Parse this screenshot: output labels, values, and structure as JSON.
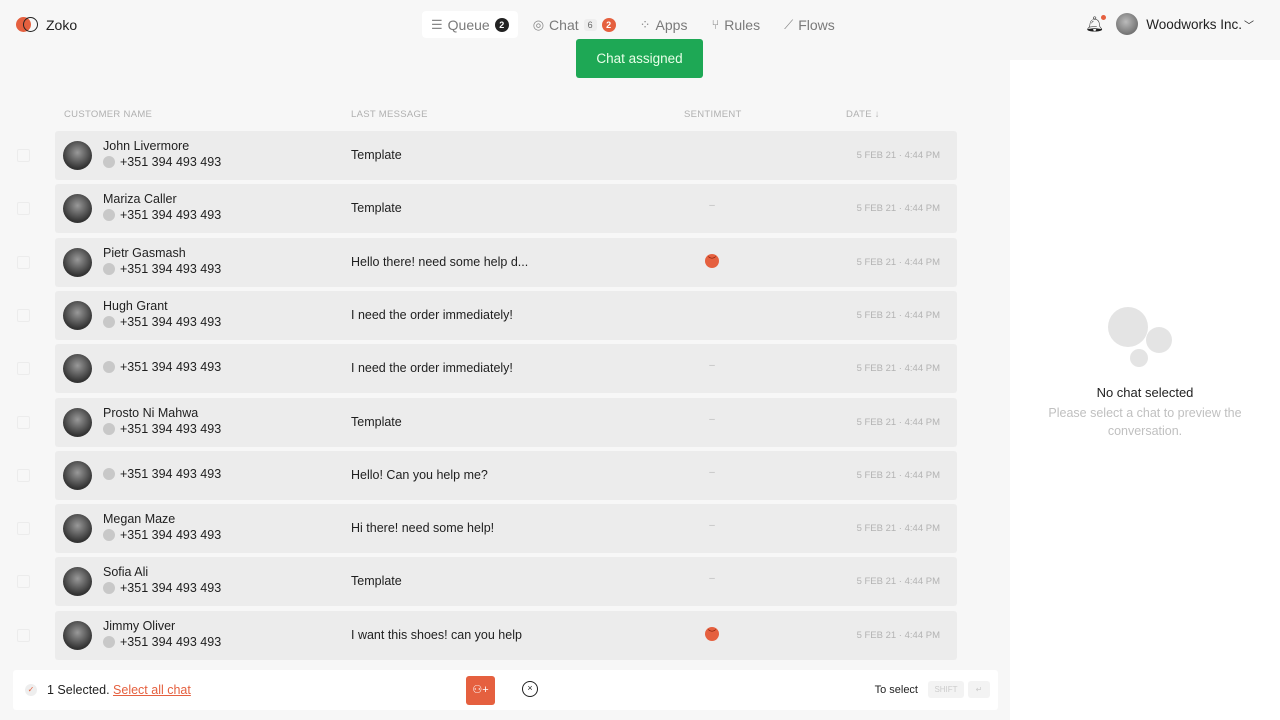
{
  "app": {
    "name": "Zoko",
    "logo_colors": [
      "#e5603f",
      "#222222"
    ]
  },
  "nav": [
    {
      "label": "Queue",
      "icon": "queue-icon",
      "badge": "2",
      "active": true
    },
    {
      "label": "Chat",
      "icon": "chat-icon",
      "count": "6",
      "badge": "2"
    },
    {
      "label": "Apps",
      "icon": "apps-icon"
    },
    {
      "label": "Rules",
      "icon": "rules-icon"
    },
    {
      "label": "Flows",
      "icon": "flows-icon"
    }
  ],
  "toast": {
    "text": "Chat assigned",
    "color": "#1ea855"
  },
  "account": {
    "name": "Woodworks Inc.",
    "notification_dot": true
  },
  "table": {
    "headers": {
      "name": "CUSTOMER NAME",
      "message": "LAST MESSAGE",
      "sentiment": "SENTIMENT",
      "date": "DATE ↓"
    },
    "rows": [
      {
        "name": "John Livermore",
        "phone": "+351 394 493 493",
        "message": "Template",
        "sentiment": "",
        "date": "5 FEB 21 · 4:44 PM"
      },
      {
        "name": "Mariza Caller",
        "phone": "+351 394 493 493",
        "message": "Template",
        "sentiment": "–",
        "date": "5 FEB 21 · 4:44 PM"
      },
      {
        "name": "Pietr Gasmash",
        "phone": "+351 394 493 493",
        "message": "Hello there! need some help d...",
        "sentiment": "angry",
        "date": "5 FEB 21 · 4:44 PM"
      },
      {
        "name": "Hugh Grant",
        "phone": "+351 394 493 493",
        "message": "I need the order immediately!",
        "sentiment": "",
        "date": "5 FEB 21 · 4:44 PM"
      },
      {
        "name": "",
        "phone": "+351 394 493 493",
        "message": "I need the order immediately!",
        "sentiment": "–",
        "date": "5 FEB 21 · 4:44 PM"
      },
      {
        "name": "Prosto Ni Mahwa",
        "phone": "+351 394 493 493",
        "message": "Template",
        "sentiment": "–",
        "date": "5 FEB 21 · 4:44 PM"
      },
      {
        "name": "",
        "phone": "+351 394 493 493",
        "message": "Hello! Can you help me?",
        "sentiment": "–",
        "date": "5 FEB 21 · 4:44 PM"
      },
      {
        "name": "Megan Maze",
        "phone": "+351 394 493 493",
        "message": "Hi there! need some help!",
        "sentiment": "–",
        "date": "5 FEB 21 · 4:44 PM"
      },
      {
        "name": "Sofia Ali",
        "phone": "+351 394 493 493",
        "message": "Template",
        "sentiment": "–",
        "date": "5 FEB 21 · 4:44 PM"
      },
      {
        "name": "Jimmy Oliver",
        "phone": "+351 394 493 493",
        "message": "I want this shoes! can you help",
        "sentiment": "angry",
        "date": "5 FEB 21 · 4:44 PM"
      }
    ]
  },
  "preview": {
    "title": "No chat selected",
    "subtitle": "Please select a chat to preview the conversation."
  },
  "selection": {
    "count_text": "1 Selected.",
    "select_all": "Select all chat",
    "hint": "To select",
    "key1": "SHIFT",
    "key2": "↵"
  }
}
